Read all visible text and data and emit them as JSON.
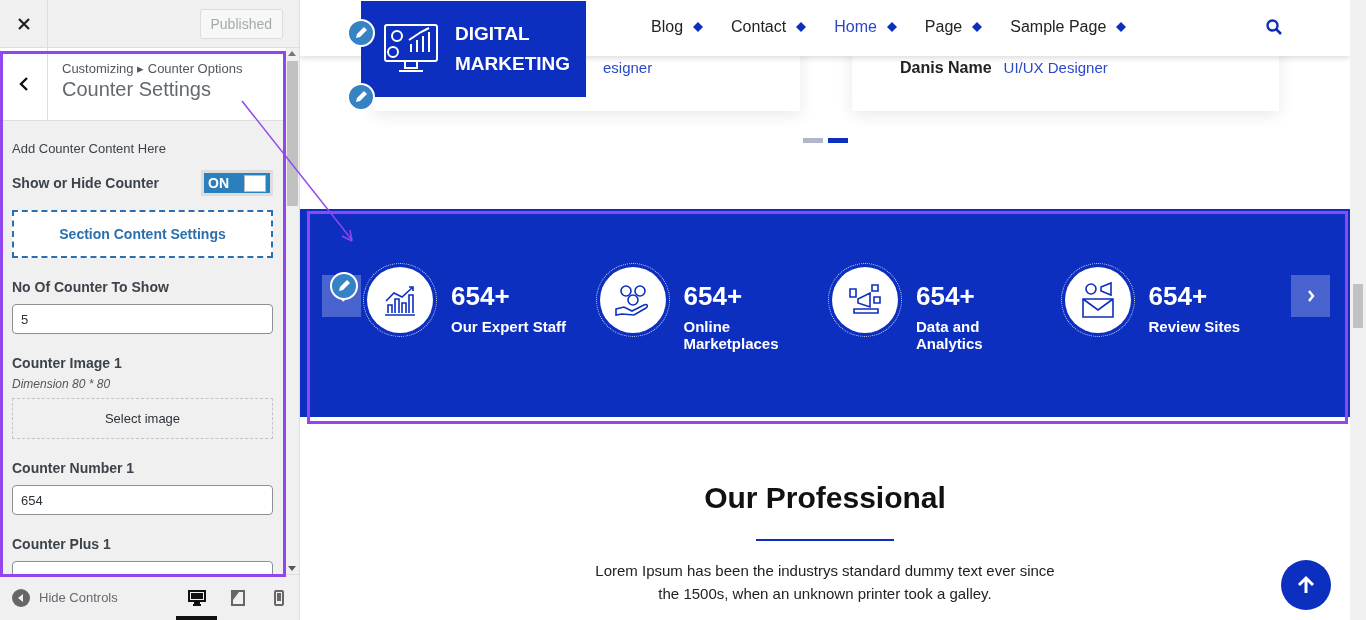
{
  "customizer": {
    "publish_button": {
      "label": "Published",
      "disabled": true
    },
    "breadcrumb": "Customizing ▸ Counter Options",
    "title": "Counter Settings",
    "intro": "Add Counter Content Here",
    "toggle": {
      "label": "Show or Hide Counter",
      "text": "ON",
      "on": true
    },
    "section_button": "Section Content Settings",
    "fields": [
      {
        "kind": "text",
        "label": "No Of Counter To Show",
        "value": "5"
      },
      {
        "kind": "image",
        "label": "Counter Image 1",
        "description": "Dimension 80 * 80",
        "button": "Select image"
      },
      {
        "kind": "text",
        "label": "Counter Number 1",
        "value": "654"
      },
      {
        "kind": "text",
        "label": "Counter Plus 1"
      }
    ],
    "footer": {
      "hide_controls": "Hide Controls",
      "devices": [
        {
          "selected": true
        },
        {
          "selected": false
        },
        {
          "selected": false
        }
      ]
    }
  },
  "preview": {
    "logo": [
      "DIGITAL",
      "MARKETING"
    ],
    "nav": [
      {
        "label": "Blog",
        "selected": false
      },
      {
        "label": "Contact",
        "selected": false
      },
      {
        "label": "Home",
        "selected": true
      },
      {
        "label": "Page",
        "selected": false
      },
      {
        "label": "Sample Page",
        "selected": false
      }
    ],
    "testimonials": [
      {
        "role": "esigner"
      },
      {
        "name": "Danis Name",
        "role": "UI/UX Designer"
      }
    ],
    "slider_dots": [
      {
        "selected": false
      },
      {
        "selected": true
      }
    ],
    "counters": [
      {
        "number": "654+",
        "label": "Our Expert Staff"
      },
      {
        "number": "654+",
        "label": "Online Marketplaces"
      },
      {
        "number": "654+",
        "label": "Data and Analytics"
      },
      {
        "number": "654+",
        "label": "Review Sites"
      }
    ],
    "heading": "Our Professional",
    "paragraph": "Lorem Ipsum has been the industrys standard dummy text ever since the 1500s, when an unknown printer took a galley."
  }
}
